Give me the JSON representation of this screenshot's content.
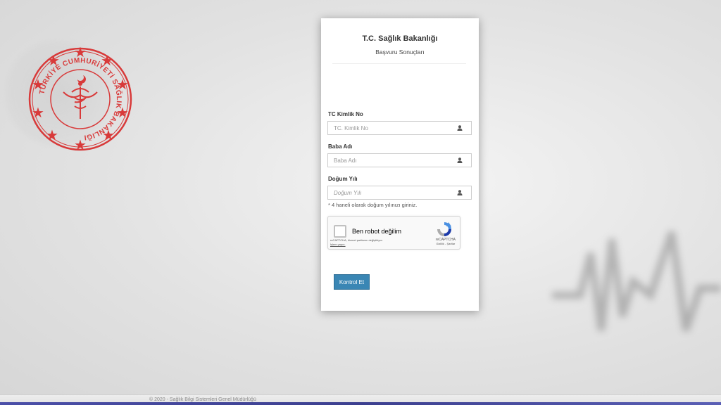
{
  "brand": {
    "seal_name": "ministry-seal",
    "seal_text": "TÜRKİYE CUMHURİYETİ SAĞLIK BAKANLIĞI",
    "seal_color": "#d83a3a"
  },
  "card": {
    "title": "T.C. Sağlık Bakanlığı",
    "subtitle": "Başvuru Sonuçları"
  },
  "form": {
    "tc": {
      "label": "TC Kimlik No",
      "placeholder": "TC. Kimlik No",
      "icon": "user-icon"
    },
    "father": {
      "label": "Baba Adı",
      "placeholder": "Baba Adı",
      "icon": "user-icon"
    },
    "birth_year": {
      "label": "Doğum Yılı",
      "placeholder": "Doğum Yılı",
      "icon": "user-icon"
    },
    "hint": "* 4 haneli olarak doğum yılınızı giriniz.",
    "submit_label": "Kontrol Et",
    "submit_color": "#3a86b4"
  },
  "captcha": {
    "label": "Ben robot değilim",
    "terms": "reCAPTCHA, hizmet şartlarını değiştiriyor.",
    "terms_link": "İşlem yapın.",
    "brand": "reCAPTCHA",
    "brand_sub": "Gizlilik - Şartlar",
    "icon": "recaptcha-logo-icon"
  },
  "footer": {
    "text": "© 2020 - Sağlık Bilgi Sistemleri Genel Müdürlüğü"
  }
}
